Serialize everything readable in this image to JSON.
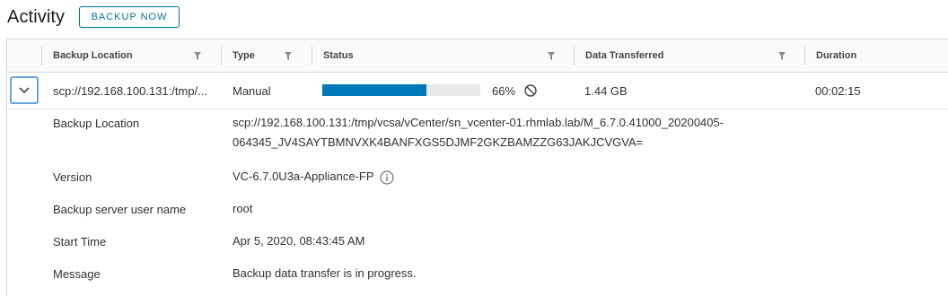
{
  "header": {
    "title": "Activity",
    "backup_now_label": "BACKUP NOW"
  },
  "grid": {
    "columns": [
      {
        "label": "Backup Location",
        "filter_icon": "filter-icon"
      },
      {
        "label": "Type",
        "filter_icon": "filter-icon"
      },
      {
        "label": "Status",
        "filter_icon": "filter-icon"
      },
      {
        "label": "Data Transferred",
        "filter_icon": "filter-icon"
      },
      {
        "label": "Duration"
      }
    ],
    "row": {
      "expand_icon": "chevron-down-icon",
      "backup_location": "scp://192.168.100.131:/tmp/...",
      "type": "Manual",
      "progress_percent": 66,
      "progress_label": "66%",
      "cancel_icon": "cancel-icon",
      "data_transferred": "1.44 GB",
      "duration": "00:02:15"
    },
    "details": {
      "backup_location_label": "Backup Location",
      "backup_location_line1": "scp://192.168.100.131:/tmp/vcsa/vCenter/sn_vcenter-01.rhmlab.lab/M_6.7.0.41000_20200405-",
      "backup_location_line2": "064345_JV4SAYTBMNVXK4BANFXGS5DJMF2GKZBAMZZG63JAKJCVGVA=",
      "version_label": "Version",
      "version_value": "VC-6.7.0U3a-Appliance-FP",
      "version_info_icon": "info-icon",
      "user_label": "Backup server user name",
      "user_value": "root",
      "start_label": "Start Time",
      "start_value": "Apr 5, 2020, 08:43:45 AM",
      "message_label": "Message",
      "message_value": "Backup data transfer is in progress."
    }
  },
  "colors": {
    "accent": "#0072a3",
    "progress": "#0079b8",
    "focus": "#6aa4dd"
  }
}
